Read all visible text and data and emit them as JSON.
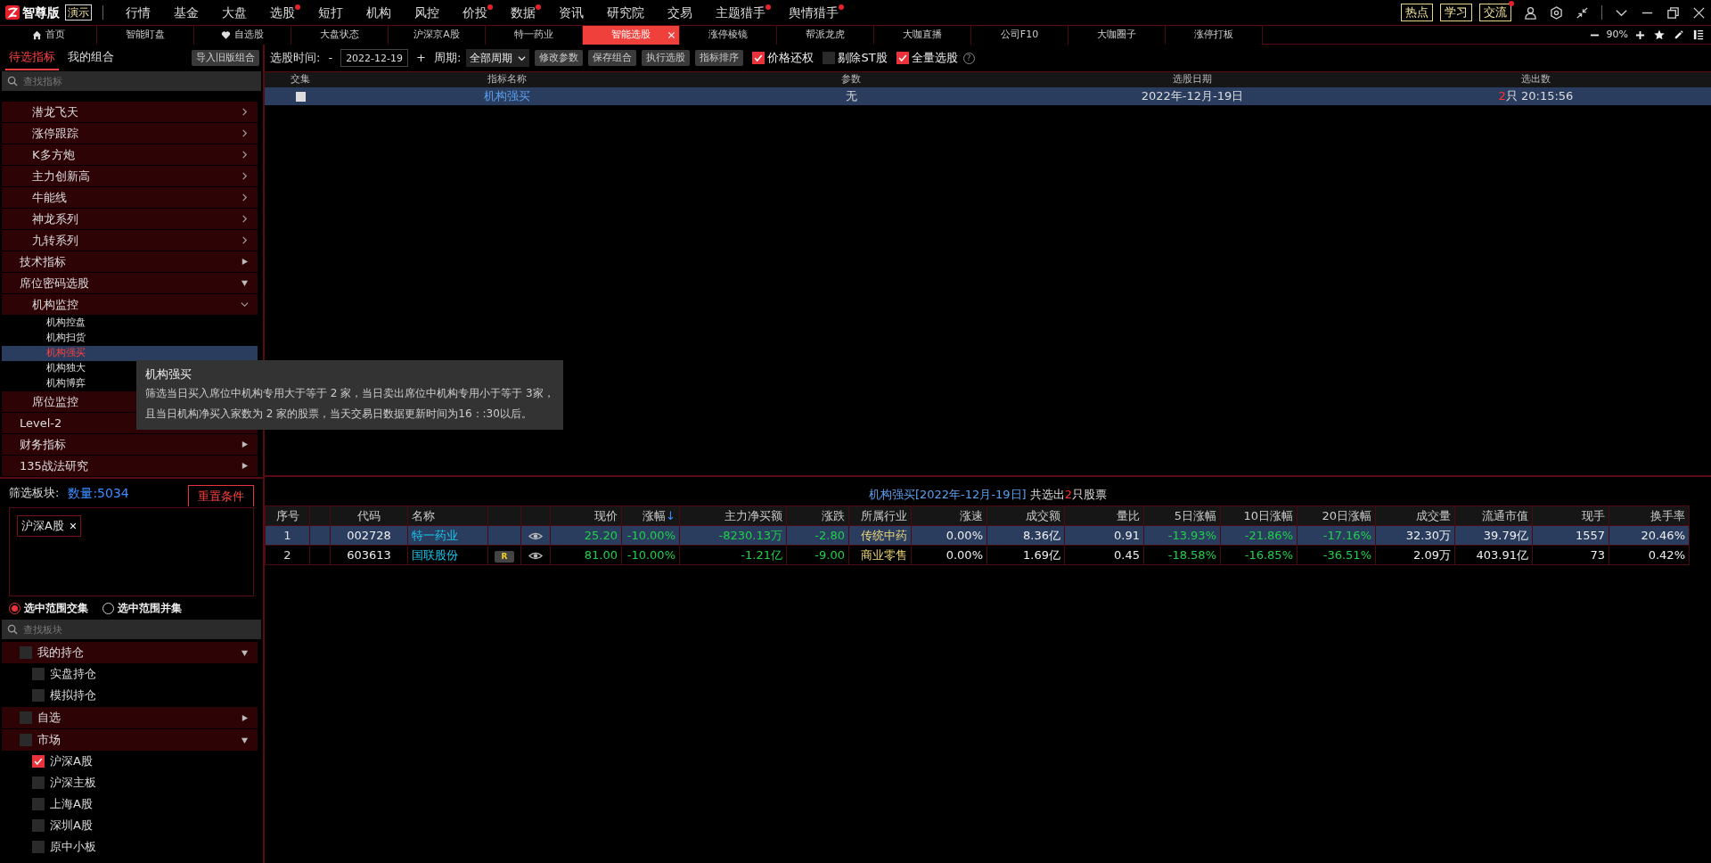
{
  "app": {
    "edition": "智尊版",
    "demo_badge": "演示"
  },
  "menu": [
    {
      "label": "行情",
      "dot": false
    },
    {
      "label": "基金",
      "dot": false
    },
    {
      "label": "大盘",
      "dot": false
    },
    {
      "label": "选股",
      "dot": true
    },
    {
      "label": "短打",
      "dot": false
    },
    {
      "label": "机构",
      "dot": false
    },
    {
      "label": "风控",
      "dot": false
    },
    {
      "label": "价投",
      "dot": true
    },
    {
      "label": "数据",
      "dot": true
    },
    {
      "label": "资讯",
      "dot": false
    },
    {
      "label": "研究院",
      "dot": false
    },
    {
      "label": "交易",
      "dot": false
    },
    {
      "label": "主题猎手",
      "dot": true
    },
    {
      "label": "舆情猎手",
      "dot": true
    }
  ],
  "quick_buttons": [
    {
      "label": "热点",
      "dot": false
    },
    {
      "label": "学习",
      "dot": false
    },
    {
      "label": "交流",
      "dot": true
    }
  ],
  "tabs": [
    {
      "label": "首页",
      "kind": "home",
      "selected": false,
      "closable": false
    },
    {
      "label": "智能盯盘",
      "selected": false,
      "closable": false
    },
    {
      "label": "自选股",
      "kind": "favorites",
      "selected": false,
      "closable": false
    },
    {
      "label": "大盘状态",
      "selected": false,
      "closable": false
    },
    {
      "label": "沪深京A股",
      "selected": false,
      "closable": false
    },
    {
      "label": "特一药业",
      "selected": false,
      "closable": false
    },
    {
      "label": "智能选股",
      "selected": true,
      "closable": true
    },
    {
      "label": "涨停棱镜",
      "selected": false,
      "closable": false
    },
    {
      "label": "帮派龙虎",
      "selected": false,
      "closable": false
    },
    {
      "label": "大咖直播",
      "selected": false,
      "closable": false
    },
    {
      "label": "公司F10",
      "selected": false,
      "closable": false
    },
    {
      "label": "大咖圈子",
      "selected": false,
      "closable": false
    },
    {
      "label": "涨停打板",
      "selected": false,
      "closable": false
    }
  ],
  "zoom_text": "90%",
  "left_tabs": [
    {
      "label": "待选指标",
      "selected": true
    },
    {
      "label": "我的组合",
      "selected": false
    }
  ],
  "import_button": "导入旧版组合",
  "indicator_search": {
    "placeholder": "查找指标"
  },
  "indicator_tree": [
    {
      "label": "潜龙飞天",
      "kind": "subgroup",
      "expanded": false
    },
    {
      "label": "涨停跟踪",
      "kind": "subgroup",
      "expanded": false
    },
    {
      "label": "K多方炮",
      "kind": "subgroup",
      "expanded": false
    },
    {
      "label": "主力创新高",
      "kind": "subgroup",
      "expanded": false
    },
    {
      "label": "牛能线",
      "kind": "subgroup",
      "expanded": false
    },
    {
      "label": "神龙系列",
      "kind": "subgroup",
      "expanded": false
    },
    {
      "label": "九转系列",
      "kind": "subgroup",
      "expanded": false
    },
    {
      "label": "技术指标",
      "kind": "group",
      "expanded": false
    },
    {
      "label": "席位密码选股",
      "kind": "group",
      "expanded": true,
      "children": [
        {
          "label": "机构监控",
          "kind": "subgroup",
          "expanded": true,
          "children": [
            {
              "label": "机构控盘",
              "kind": "leaf",
              "selected": false
            },
            {
              "label": "机构扫货",
              "kind": "leaf",
              "selected": false
            },
            {
              "label": "机构强买",
              "kind": "leaf",
              "selected": true
            },
            {
              "label": "机构独大",
              "kind": "leaf",
              "selected": false
            },
            {
              "label": "机构博弈",
              "kind": "leaf",
              "selected": false
            }
          ]
        },
        {
          "label": "席位监控",
          "kind": "subgroup"
        }
      ]
    },
    {
      "label": "Level-2",
      "kind": "group"
    },
    {
      "label": "财务指标",
      "kind": "group",
      "expanded": false
    },
    {
      "label": "135战法研究",
      "kind": "group",
      "expanded": false
    }
  ],
  "tooltip": {
    "title": "机构强买",
    "lines": [
      "筛选当日买入席位中机构专用大于等于 2 家，当日卖出席位中机构专用小于等于 3家，",
      "且当日机构净买入家数为 2 家的股票，当天交易日数据更新时间为16：:30以后。"
    ]
  },
  "filter": {
    "label": "筛选板块:",
    "count": "数量:5034",
    "reset_button": "重置条件",
    "tags": [
      {
        "label": "沪深A股"
      }
    ],
    "modes": [
      {
        "label": "选中范围交集",
        "selected": true
      },
      {
        "label": "选中范围并集",
        "selected": false
      }
    ],
    "search": {
      "placeholder": "查找板块"
    }
  },
  "sector_tree": [
    {
      "label": "我的持仓",
      "kind": "group",
      "checked": false,
      "expanded": true,
      "children": [
        {
          "label": "实盘持仓",
          "kind": "leaf",
          "checked": false
        },
        {
          "label": "模拟持仓",
          "kind": "leaf",
          "checked": false
        }
      ]
    },
    {
      "label": "自选",
      "kind": "group",
      "checked": false,
      "expanded": false
    },
    {
      "label": "市场",
      "kind": "group",
      "checked": false,
      "expanded": true,
      "children": [
        {
          "label": "沪深A股",
          "kind": "leaf",
          "checked": true
        },
        {
          "label": "沪深主板",
          "kind": "leaf",
          "checked": false
        },
        {
          "label": "上海A股",
          "kind": "leaf",
          "checked": false
        },
        {
          "label": "深圳A股",
          "kind": "leaf",
          "checked": false
        },
        {
          "label": "原中小板",
          "kind": "leaf",
          "checked": false
        }
      ]
    }
  ],
  "toolbar": {
    "date_label": "选股时间:",
    "minus": "-",
    "date": "2022-12-19",
    "plus": "+",
    "period_label": "周期:",
    "period": "全部周期",
    "buttons": [
      "修改参数",
      "保存组合",
      "执行选股",
      "指标排序"
    ],
    "options": [
      {
        "label": "价格还权",
        "checked": true
      },
      {
        "label": "剔除ST股",
        "checked": false
      },
      {
        "label": "全量选股",
        "checked": true
      }
    ],
    "help": "?"
  },
  "strategy_table": {
    "columns": [
      "交集",
      "指标名称",
      "参数",
      "选股日期",
      "选出数"
    ],
    "rows": [
      {
        "selected": true,
        "checked": false,
        "name": "机构强买",
        "params": "无",
        "date": "2022年-12月-19日",
        "count": "2",
        "suffix": "只 20:15:56"
      }
    ]
  },
  "result": {
    "title": {
      "name": "机构强买[2022年-12月-19日]",
      "prefix": " 共选出",
      "count": "2",
      "suffix": "只股票"
    },
    "columns": [
      {
        "label": "序号",
        "kind": "index"
      },
      {
        "kind": "spacer"
      },
      {
        "label": "代码",
        "kind": "code"
      },
      {
        "label": "名称",
        "kind": "name"
      },
      {
        "kind": "badge"
      },
      {
        "kind": "watch"
      },
      {
        "label": "现价",
        "kind": "down"
      },
      {
        "label": "涨幅",
        "kind": "down",
        "sort_arrow": "↓"
      },
      {
        "label": "主力净买额",
        "kind": "down"
      },
      {
        "label": "涨跌",
        "kind": "down"
      },
      {
        "label": "所属行业",
        "kind": "industry"
      },
      {
        "label": "涨速",
        "kind": "plain"
      },
      {
        "label": "成交额",
        "kind": "plain"
      },
      {
        "label": "量比",
        "kind": "plain"
      },
      {
        "label": "5日涨幅",
        "kind": "down"
      },
      {
        "label": "10日涨幅",
        "kind": "down"
      },
      {
        "label": "20日涨幅",
        "kind": "down"
      },
      {
        "label": "成交量",
        "kind": "plain"
      },
      {
        "label": "流通市值",
        "kind": "plain"
      },
      {
        "label": "现手",
        "kind": "plain"
      },
      {
        "label": "换手率",
        "kind": "plain"
      }
    ],
    "rows": [
      {
        "selected": true,
        "index": "1",
        "code": "002728",
        "name": "特一药业",
        "values": [
          "25.20",
          "-10.00%",
          "-8230.13万",
          "-2.80",
          "传统中药",
          "0.00%",
          "8.36亿",
          "0.91",
          "-13.93%",
          "-21.86%",
          "-17.16%",
          "32.30万",
          "39.79亿",
          "1557",
          "20.46%"
        ]
      },
      {
        "selected": false,
        "index": "2",
        "code": "603613",
        "name": "国联股份",
        "badge": "R",
        "values": [
          "81.00",
          "-10.00%",
          "-1.21亿",
          "-9.00",
          "商业零售",
          "0.00%",
          "1.69亿",
          "0.45",
          "-18.58%",
          "-16.85%",
          "-36.51%",
          "2.09万",
          "403.91亿",
          "73",
          "0.42%"
        ]
      }
    ]
  }
}
